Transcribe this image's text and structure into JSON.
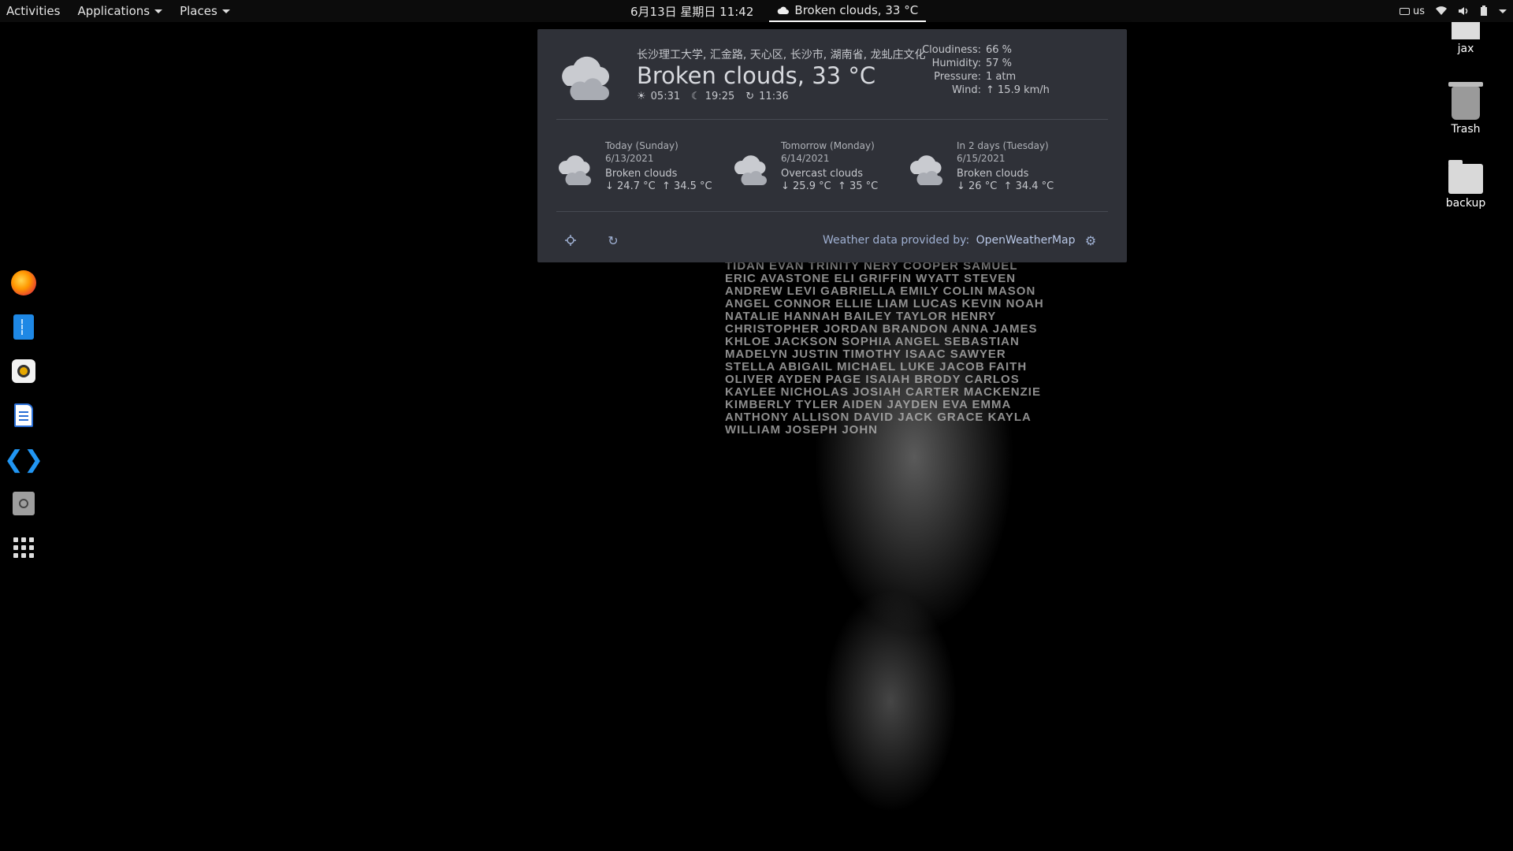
{
  "topbar": {
    "activities": "Activities",
    "applications": "Applications",
    "places": "Places",
    "datetime": "6月13日 星期日  11:42",
    "weather_indicator": "Broken clouds, 33 °C",
    "keyboard_layout": "us"
  },
  "desktop": {
    "icons": [
      "jax",
      "Trash",
      "backup"
    ]
  },
  "dock": {
    "items": [
      "firefox-icon",
      "files-icon",
      "rhythmbox-icon",
      "text-editor-icon",
      "vscode-icon",
      "disk-icon",
      "app-grid-icon"
    ]
  },
  "weather": {
    "location": "长沙理工大学, 汇金路, 天心区, 长沙市, 湖南省, 龙虬庄文化",
    "summary": "Broken clouds, 33 °C",
    "sunrise": "05:31",
    "sunset": "19:25",
    "updated": "11:36",
    "stats": [
      {
        "label": "Cloudiness:",
        "value": "66 %"
      },
      {
        "label": "Humidity:",
        "value": "57 %"
      },
      {
        "label": "Pressure:",
        "value": "1 atm"
      },
      {
        "label": "Wind:",
        "value": "↑  15.9 km/h"
      }
    ],
    "forecast": [
      {
        "day": "Today (Sunday)",
        "date": "6/13/2021",
        "desc": "Broken clouds",
        "low": "↓  24.7 °C",
        "high": "↑  34.5 °C"
      },
      {
        "day": "Tomorrow (Monday)",
        "date": "6/14/2021",
        "desc": "Overcast clouds",
        "low": "↓  25.9 °C",
        "high": "↑  35 °C"
      },
      {
        "day": "In 2 days (Tuesday)",
        "date": "6/15/2021",
        "desc": "Broken clouds",
        "low": "↓  26 °C",
        "high": "↑  34.4 °C"
      }
    ],
    "provider_label": "Weather data provided by:",
    "provider_name": "OpenWeatherMap"
  },
  "wallpaper_text": "TIDAN EVAN TRINITY NERY COOPER SAMUEL ERIC AVASTONE ELI GRIFFIN WYATT STEVEN ANDREW LEVI GABRIELLA EMILY COLIN MASON ANGEL CONNOR ELLIE LIAM LUCAS KEVIN NOAH NATALIE HANNAH BAILEY TAYLOR HENRY CHRISTOPHER JORDAN BRANDON ANNA JAMES KHLOE JACKSON SOPHIA ANGEL SEBASTIAN MADELYN JUSTIN TIMOTHY ISAAC SAWYER STELLA ABIGAIL MICHAEL LUKE JACOB FAITH OLIVER AYDEN PAGE ISAIAH BRODY CARLOS KAYLEE NICHOLAS JOSIAH CARTER MACKENZIE KIMBERLY TYLER AIDEN JAYDEN EVA EMMA ANTHONY ALLISON DAVID JACK GRACE KAYLA WILLIAM JOSEPH JOHN"
}
